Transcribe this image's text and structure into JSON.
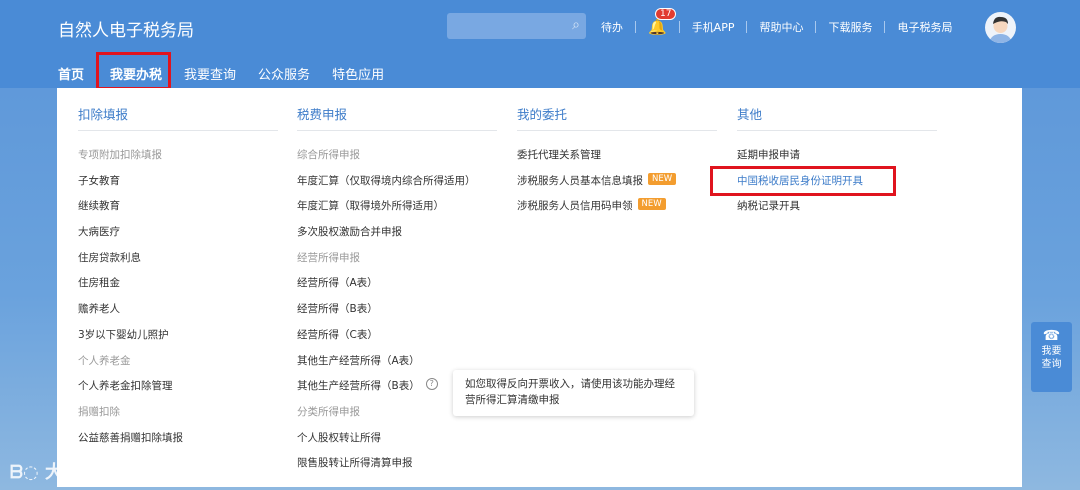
{
  "header": {
    "title": "自然人电子税务局",
    "search_placeholder": "",
    "links": [
      "待办",
      "手机APP",
      "帮助中心",
      "下载服务",
      "电子税务局"
    ],
    "notification_count": "17"
  },
  "nav": [
    "首页",
    "我要办税",
    "我要查询",
    "公众服务",
    "特色应用"
  ],
  "columns": [
    {
      "title": "扣除填报",
      "items": [
        {
          "t": "专项附加扣除填报",
          "g": 1
        },
        {
          "t": "子女教育"
        },
        {
          "t": "继续教育"
        },
        {
          "t": "大病医疗"
        },
        {
          "t": "住房贷款利息"
        },
        {
          "t": "住房租金"
        },
        {
          "t": "赡养老人"
        },
        {
          "t": "3岁以下婴幼儿照护"
        },
        {
          "t": "个人养老金",
          "g": 1
        },
        {
          "t": "个人养老金扣除管理"
        },
        {
          "t": "捐赠扣除",
          "g": 1
        },
        {
          "t": "公益慈善捐赠扣除填报"
        }
      ]
    },
    {
      "title": "税费申报",
      "items": [
        {
          "t": "综合所得申报",
          "g": 1
        },
        {
          "t": "年度汇算（仅取得境内综合所得适用）"
        },
        {
          "t": "年度汇算（取得境外所得适用）"
        },
        {
          "t": "多次股权激励合并申报"
        },
        {
          "t": "经营所得申报",
          "g": 1
        },
        {
          "t": "经营所得（A表）"
        },
        {
          "t": "经营所得（B表）"
        },
        {
          "t": "经营所得（C表）"
        },
        {
          "t": "其他生产经营所得（A表）"
        },
        {
          "t": "其他生产经营所得（B表）",
          "q": 1
        },
        {
          "t": "分类所得申报",
          "g": 1
        },
        {
          "t": "个人股权转让所得"
        },
        {
          "t": "限售股转让所得清算申报"
        }
      ]
    },
    {
      "title": "我的委托",
      "items": [
        {
          "t": "委托代理关系管理"
        },
        {
          "t": "涉税服务人员基本信息填报",
          "n": 1
        },
        {
          "t": "涉税服务人员信用码申领",
          "n": 1
        }
      ]
    },
    {
      "title": "其他",
      "items": [
        {
          "t": "延期申报申请"
        },
        {
          "t": "中国税收居民身份证明开具",
          "hl": 1
        },
        {
          "t": "纳税记录开具"
        }
      ]
    }
  ],
  "new_badge": "NEW",
  "tooltip": "如您取得反向开票收入，请使用该功能办理经营所得汇算清缴申报",
  "float_button": "我要查询",
  "watermark": "大数跨境"
}
